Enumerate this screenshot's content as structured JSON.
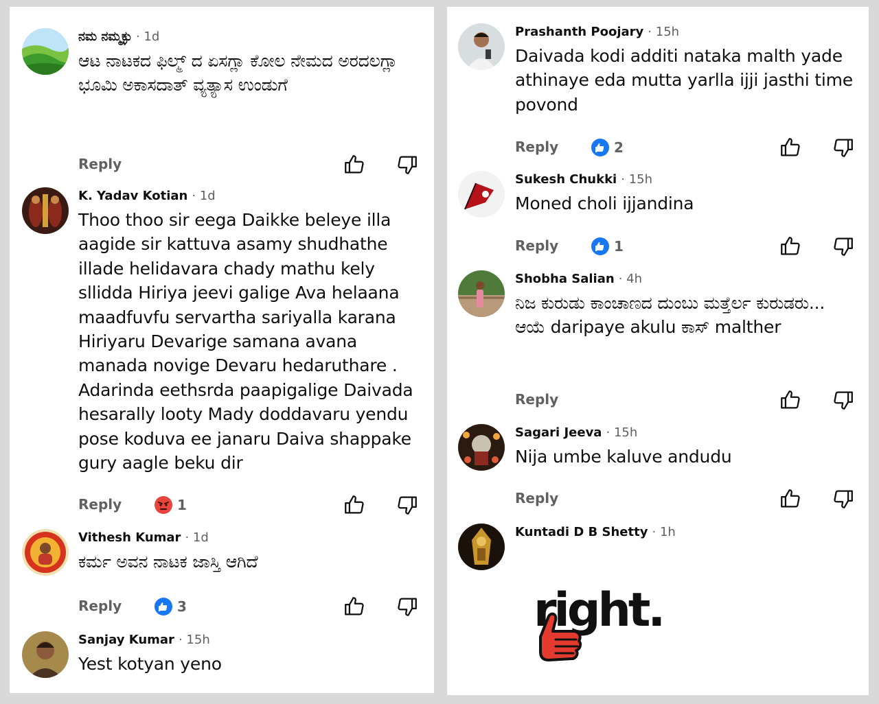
{
  "left_comments": [
    {
      "author": "ನಮ ನಮ್ಮಕ್ಳು",
      "time": "· 1d",
      "text": "ಆಟ ನಾಟಕದ ಫಿಲ್ಮ್ ದ ಏಸಗ್ಲಾ ಕೋಲ ನೇಮದ ಅರದಲಗ್ಲಾ ಭೂಮಿ ಅಕಾಸದಾತ್ ವ್ಯತ್ಯಾಸ ಉಂಡುಗೆ",
      "reply": "Reply",
      "avatar_icon": "green-hills-avatar"
    },
    {
      "author": "K. Yadav Kotian",
      "time": "· 1d",
      "text": "Thoo thoo sir eega Daikke beleye illa aagide sir kattuva asamy shudhathe illade helidavara chady mathu kely sllidda Hiriya jeevi galige Ava helaana maadfuvfu servartha sariyalla karana Hiriyaru Devarige samana avana manada novige Devaru hedaruthare . Adarinda eethsrda paapigalige Daivada hesarally looty Mady doddavaru yendu pose koduva ee janaru Daiva shappake gury aagle beku dir",
      "reply": "Reply",
      "reaction_icon": "angry-emoji-icon",
      "reaction_count": "1",
      "avatar_icon": "deity-avatar"
    },
    {
      "author": "Vithesh Kumar",
      "time": "· 1d",
      "text": "ಕರ್ಮ ಅವನ ನಾಟಕ ಜಾಸ್ತಿ ಆಗಿದೆ",
      "reply": "Reply",
      "reaction_icon": "blue-like-icon",
      "reaction_count": "3",
      "avatar_icon": "badge-avatar"
    },
    {
      "author": "Sanjay Kumar",
      "time": "· 15h",
      "text": "Yest kotyan yeno",
      "avatar_icon": "man-avatar"
    }
  ],
  "right_comments": [
    {
      "author": "Prashanth Poojary",
      "time": "· 15h",
      "text": "Daivada kodi additi nataka malth yade athinaye eda mutta yarlla ijji jasthi time povond",
      "reply": "Reply",
      "reaction_icon": "blue-like-icon",
      "reaction_count": "2",
      "avatar_icon": "man-selfie-avatar"
    },
    {
      "author": "Sukesh Chukki",
      "time": "· 15h",
      "text": "Moned choli ijjandina",
      "reply": "Reply",
      "reaction_icon": "blue-like-icon",
      "reaction_count": "1",
      "avatar_icon": "red-flag-avatar"
    },
    {
      "author": "Shobha Salian",
      "time": "· 4h",
      "text": "ನಿಜ ಕುರುಡು ಕಾಂಚಾಣದ ದುಂಬು ಮತ್ತೆರ್ಲ ಕುರುಡರು... ಆಯೆ daripaye akulu ಕಾಸ್ malther",
      "reply": "Reply",
      "avatar_icon": "woman-bridge-avatar"
    },
    {
      "author": "Sagari Jeeva",
      "time": "· 15h",
      "text": "Nija umbe kaluve andudu",
      "reply": "Reply",
      "avatar_icon": "idol-avatar"
    },
    {
      "author": "Kuntadi D B Shetty",
      "time": "· 1h",
      "avatar_icon": "golden-idol-avatar"
    }
  ],
  "sticker": {
    "text": "right.",
    "icon": "thumbs-up-sticker-icon"
  },
  "colors": {
    "blue_like": "#1877f2",
    "angry": "#e8453c",
    "muted_text": "#606060"
  }
}
